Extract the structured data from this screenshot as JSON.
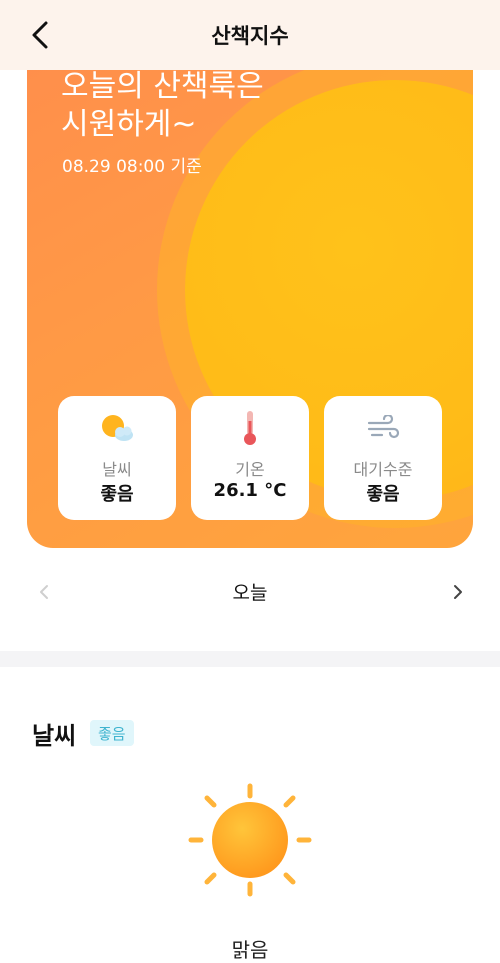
{
  "header": {
    "title": "산책지수"
  },
  "hero": {
    "title": "오늘의 산책룩은\n시원하게~",
    "timestamp": "08.29 08:00 기준"
  },
  "stats": [
    {
      "label": "날씨",
      "value": "좋음",
      "icon": "partly-cloudy-icon"
    },
    {
      "label": "기온",
      "value": "26.1 °C",
      "icon": "thermometer-icon"
    },
    {
      "label": "대기수준",
      "value": "좋음",
      "icon": "wind-icon"
    }
  ],
  "day_nav": {
    "label": "오늘"
  },
  "weather_section": {
    "title": "날씨",
    "badge": "좋음",
    "icon": "sun-icon",
    "description": "맑음"
  },
  "colors": {
    "hero_orange": "#ff9a45",
    "sun_yellow": "#ffbb18",
    "badge_bg": "#e0f6fb",
    "badge_text": "#3fb4cf"
  }
}
